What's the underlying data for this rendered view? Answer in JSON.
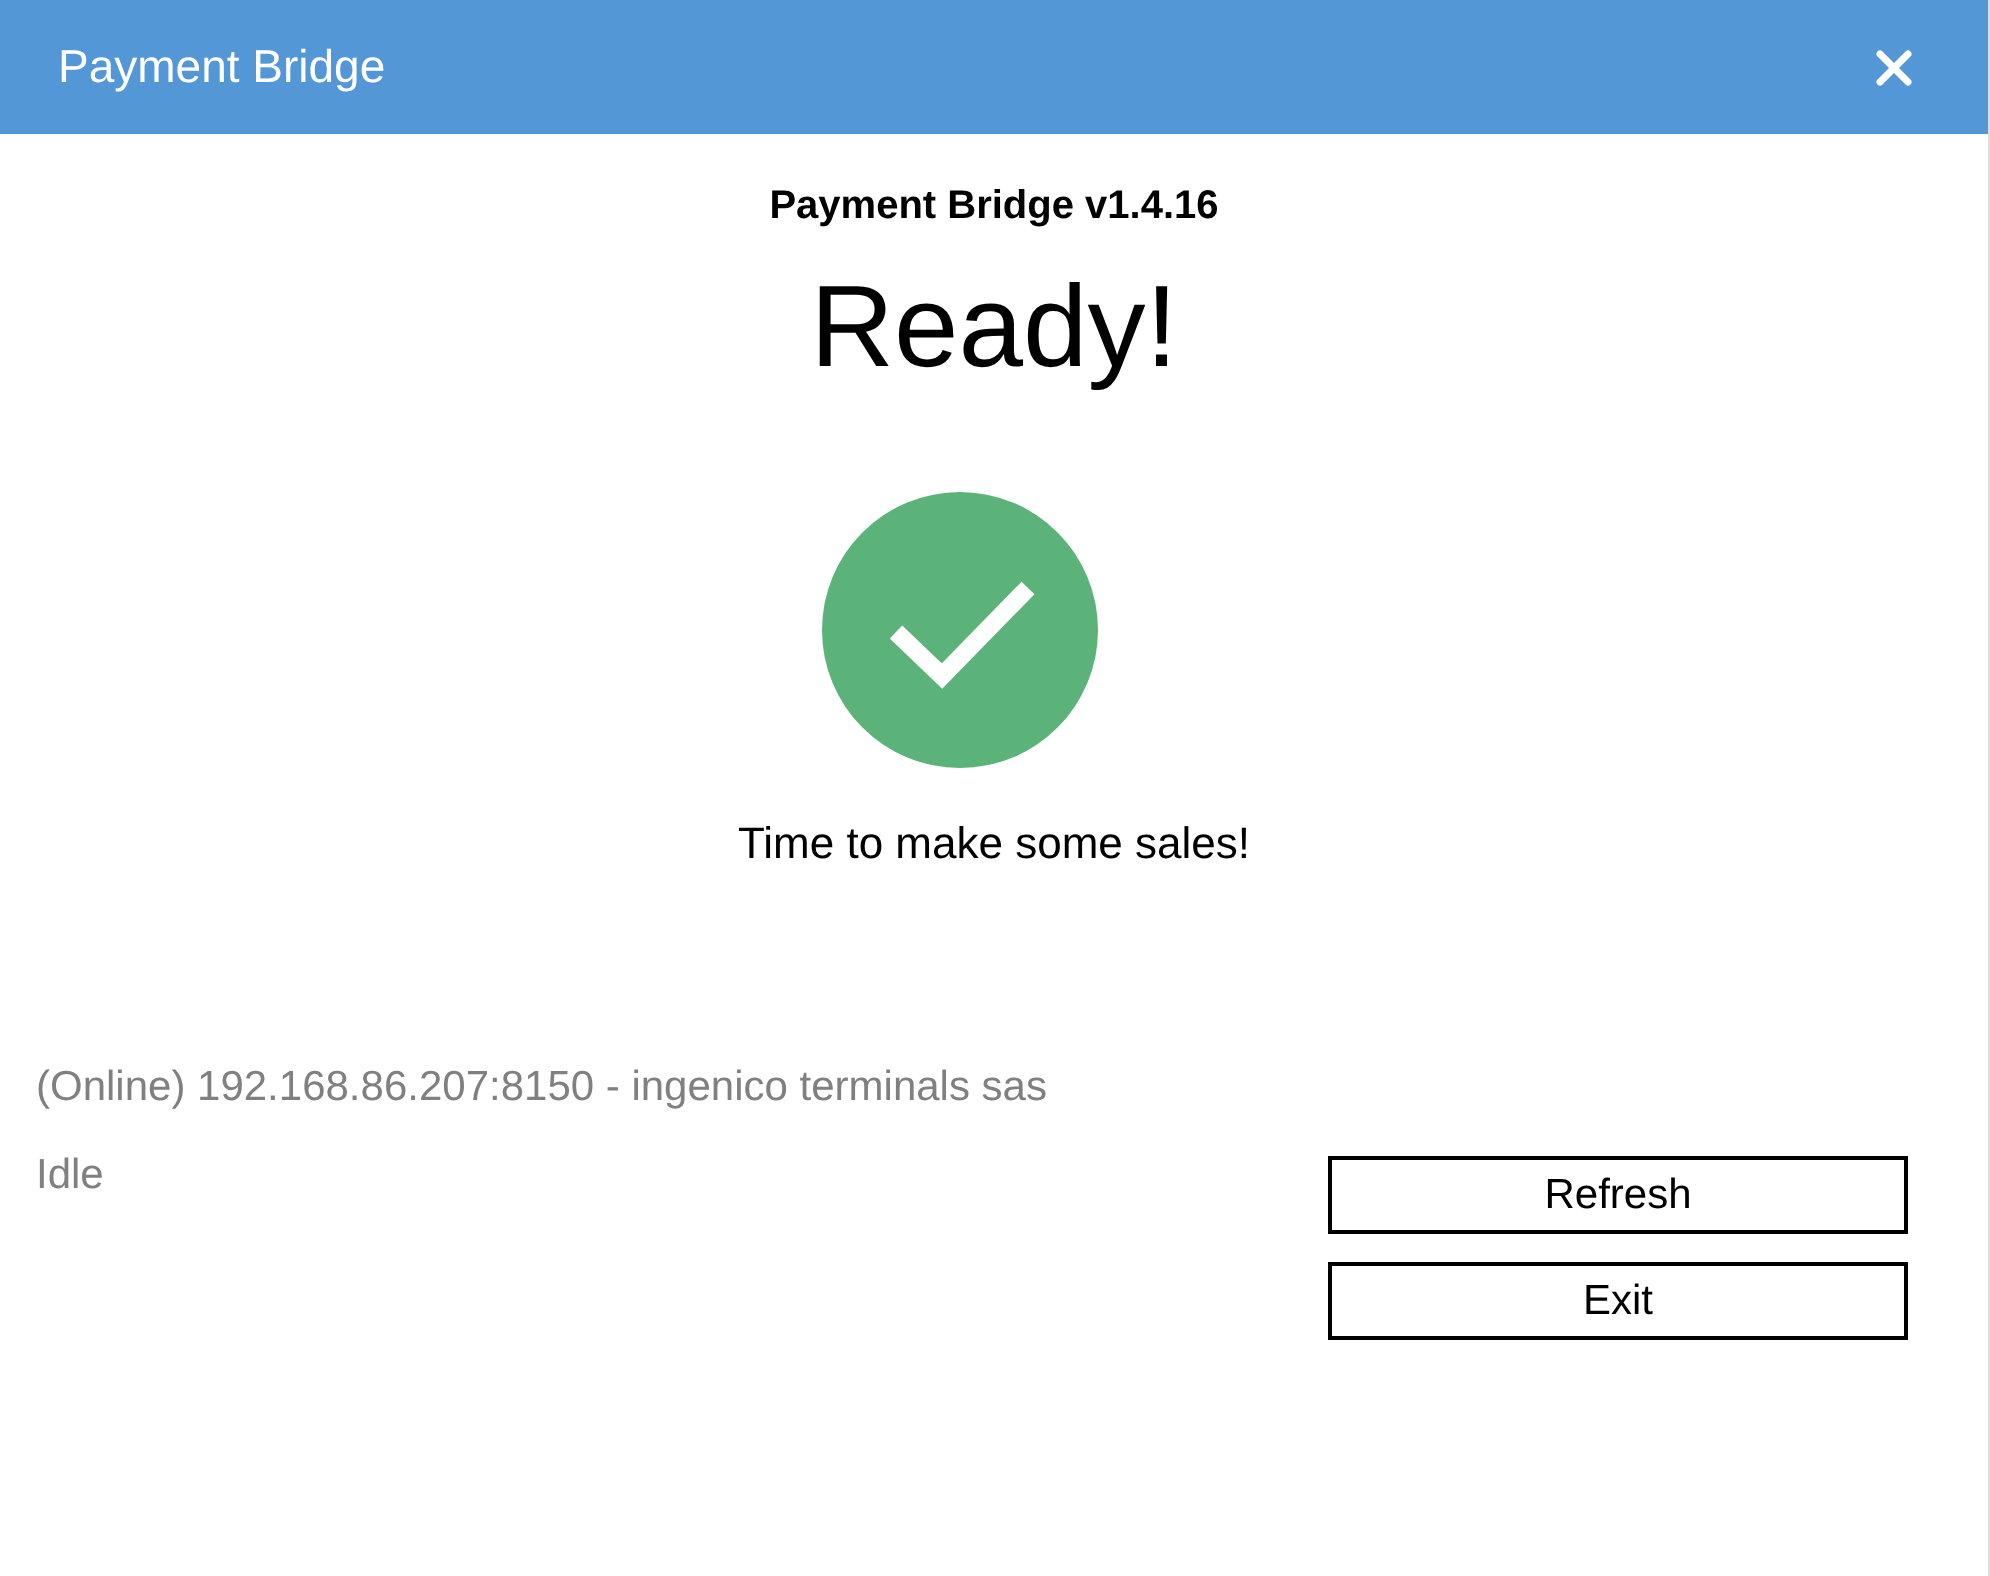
{
  "window": {
    "title": "Payment Bridge"
  },
  "version": "Payment Bridge v1.4.16",
  "heading": "Ready!",
  "status_icon": {
    "kind": "success"
  },
  "message": "Time to make some sales!",
  "connection": "(Online) 192.168.86.207:8150 - ingenico terminals sas",
  "state": "Idle",
  "buttons": [
    "Refresh",
    "Exit"
  ]
}
